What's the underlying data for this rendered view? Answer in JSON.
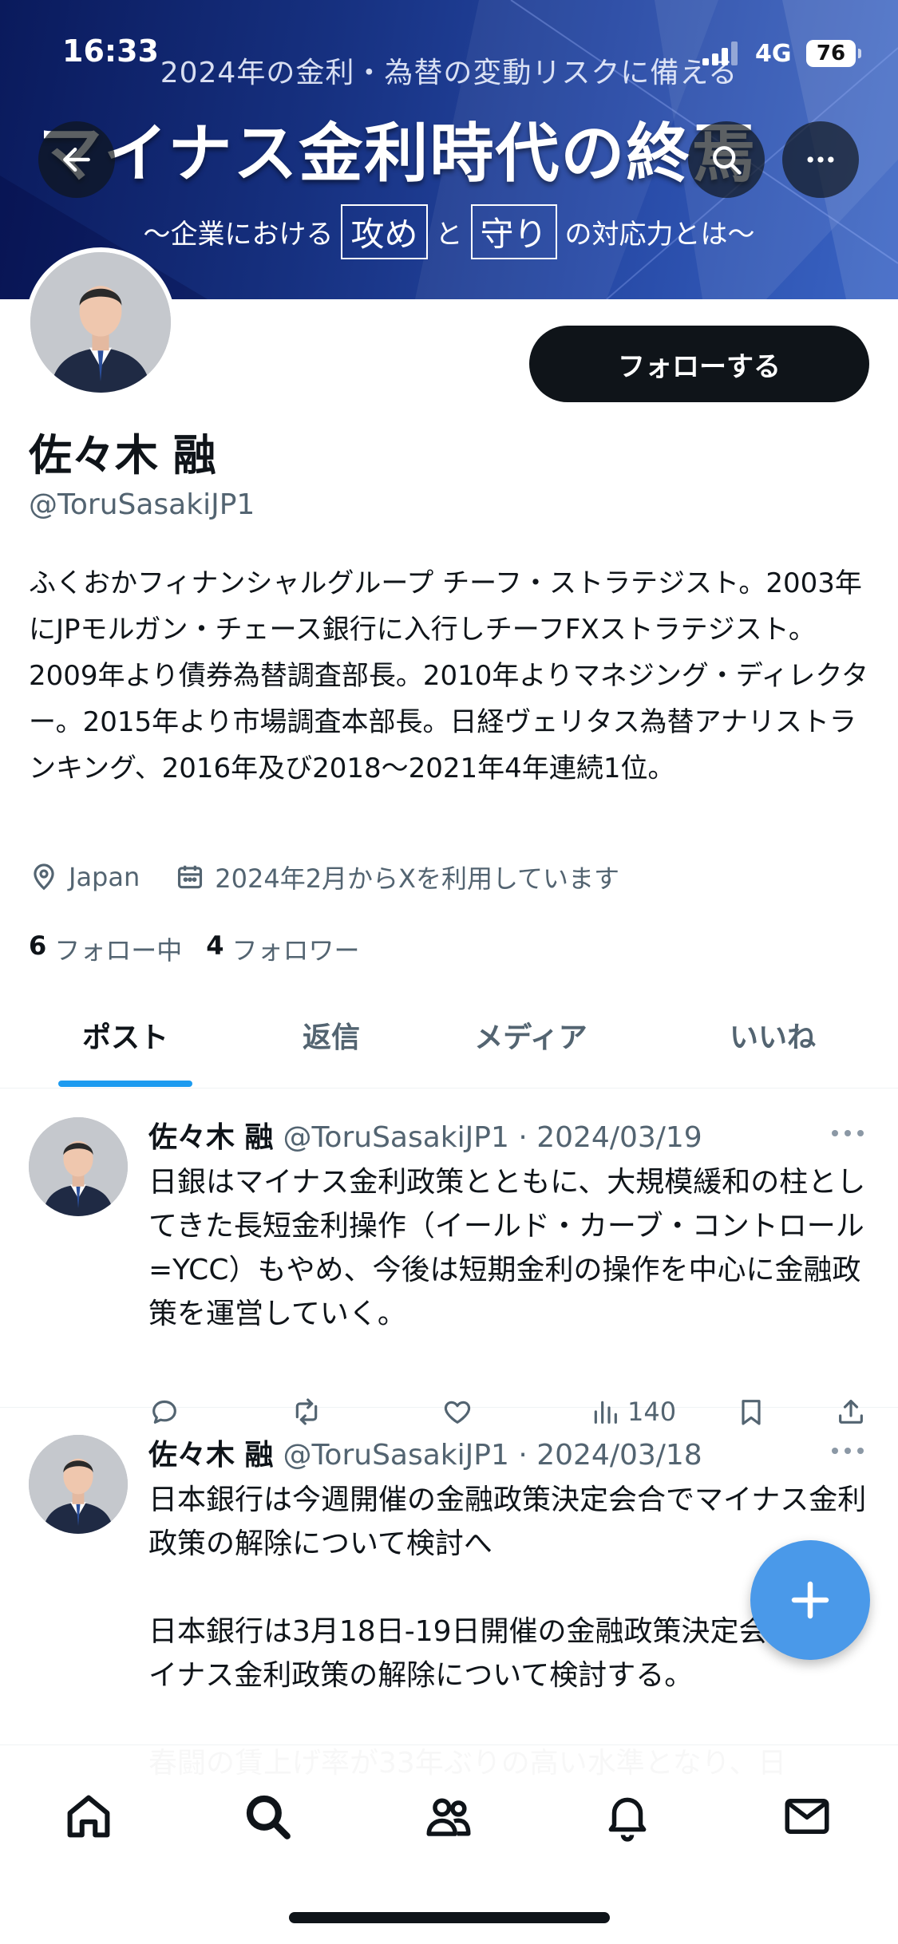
{
  "status_bar": {
    "time": "16:33",
    "network": "4G",
    "battery": "76"
  },
  "banner": {
    "line1": "2024年の金利・為替の変動リスクに備える",
    "line2": "マイナス金利時代の終焉",
    "line3_prefix": "〜企業における",
    "line3_box1": "攻め",
    "line3_mid": "と",
    "line3_box2": "守り",
    "line3_suffix": "の対応力とは〜",
    "colors": {
      "dark": "#0a1a5c",
      "light": "#3a64c4"
    }
  },
  "profile": {
    "follow_label": "フォローする",
    "display_name": "佐々木 融",
    "handle": "@ToruSasakiJP1",
    "bio": "ふくおかフィナンシャルグループ チーフ・ストラテジスト。2003年にJPモルガン・チェース銀行に入行しチーフFXストラテジスト。2009年より債券為替調査部長。2010年よりマネジング・ディレクター。2015年より市場調査本部長。日経ヴェリタス為替アナリストランキング、2016年及び2018〜2021年4年連続1位。",
    "location": "Japan",
    "joined": "2024年2月からXを利用しています",
    "following_count": "6",
    "following_label": "フォロー中",
    "followers_count": "4",
    "followers_label": "フォロワー"
  },
  "tabs": [
    {
      "label": "ポスト",
      "active": true
    },
    {
      "label": "返信",
      "active": false
    },
    {
      "label": "メディア",
      "active": false
    },
    {
      "label": "いいね",
      "active": false
    }
  ],
  "posts": [
    {
      "name": "佐々木 融",
      "handle_date": "@ToruSasakiJP1 · 2024/03/19",
      "text": "日銀はマイナス金利政策とともに、大規模緩和の柱としてきた長短金利操作（イールド・カーブ・コントロール=YCC）もやめ、今後は短期金利の操作を中心に金融政策を運営していく。",
      "views": "140"
    },
    {
      "name": "佐々木 融",
      "handle_date": "@ToruSasakiJP1 · 2024/03/18",
      "text": "日本銀行は今週開催の金融政策決定会合でマイナス金利政策の解除について検討へ\n\n日本銀行は3月18日-19日開催の金融政策決定会合でマイナス金利政策の解除について検討する。\n\n春闘の賃上げ率が33年ぶりの高い水準となり、日"
    }
  ],
  "icons": {
    "back": "arrow-left-icon",
    "search": "search-icon",
    "more": "more-icon",
    "location": "location-pin-icon",
    "calendar": "calendar-icon",
    "reply": "reply-icon",
    "repost": "repost-icon",
    "like": "heart-icon",
    "views": "views-chart-icon",
    "bookmark": "bookmark-icon",
    "share": "share-icon",
    "compose": "plus-icon",
    "nav": [
      "home-icon",
      "search-icon",
      "communities-icon",
      "notifications-icon",
      "messages-icon"
    ]
  },
  "accent_color": "#1d9bf0"
}
